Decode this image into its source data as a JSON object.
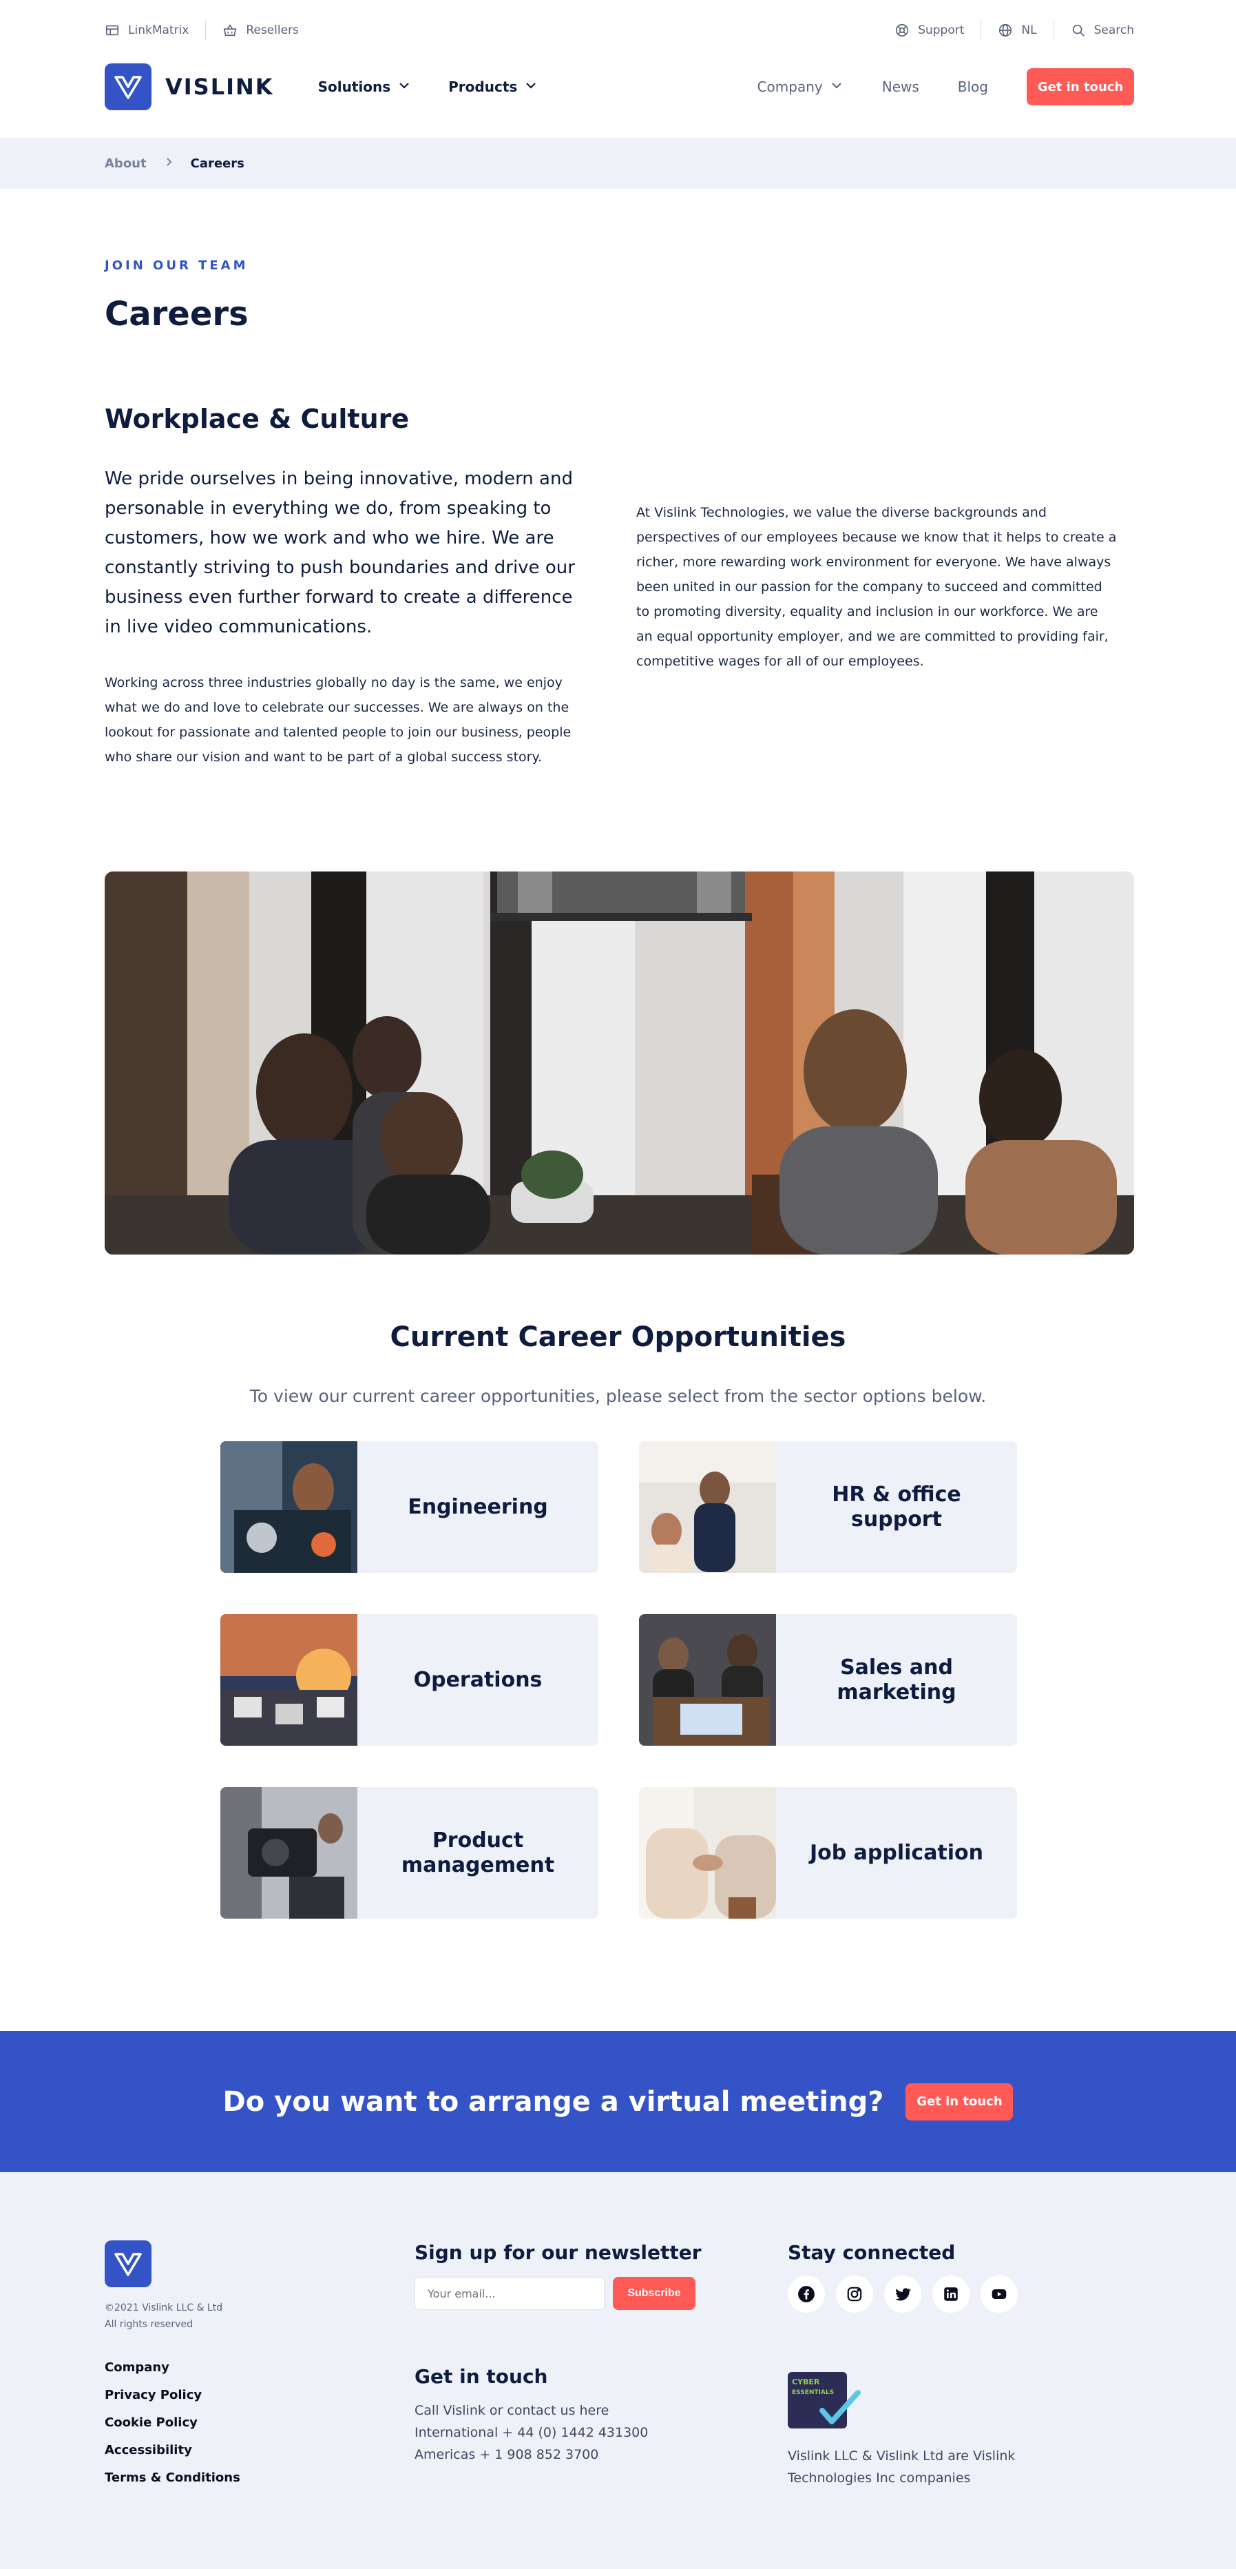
{
  "utility": {
    "left": [
      {
        "icon": "table-icon",
        "label": "LinkMatrix"
      },
      {
        "icon": "basket-icon",
        "label": "Resellers"
      }
    ],
    "right": [
      {
        "icon": "support-icon",
        "label": "Support"
      },
      {
        "icon": "globe-icon",
        "label": "NL"
      },
      {
        "icon": "search-icon",
        "label": "Search"
      }
    ]
  },
  "nav": {
    "brand": "VISLINK",
    "left": [
      "Solutions",
      "Products"
    ],
    "right": [
      {
        "label": "Company",
        "dropdown": true
      },
      {
        "label": "News",
        "dropdown": false
      },
      {
        "label": "Blog",
        "dropdown": false
      }
    ],
    "cta": "Get in touch"
  },
  "breadcrumb": {
    "parent": "About",
    "current": "Careers"
  },
  "intro": {
    "eyebrow": "JOIN OUR TEAM",
    "title": "Careers",
    "section_title": "Workplace & Culture",
    "lead": "We pride ourselves in being innovative, modern and personable in everything we do, from speaking to customers, how we work and who we hire. We are constantly striving to push boundaries and drive our business even further forward to create a difference in live video communications.",
    "body_left": "Working across three industries globally no day is the same, we enjoy what we do and love to celebrate our successes. We are always on the lookout for passionate and talented people to join our business, people who share our vision and want to be part of a global success story.",
    "body_right": "At Vislink Technologies, we value the diverse backgrounds and perspectives of our employees because we know that it helps to create a richer, more rewarding work environment for everyone. We have always been united in our passion for the company to succeed and committed to promoting diversity, equality and inclusion in our workforce. We are an equal opportunity employer, and we are committed to providing fair, competitive wages for all of our employees."
  },
  "opportunities": {
    "title": "Current Career Opportunities",
    "subtitle": "To view our current career opportunities, please select from the sector options below.",
    "cards": [
      {
        "label": "Engineering",
        "name": "card-engineering"
      },
      {
        "label": "HR & office support",
        "name": "card-hr-office-support"
      },
      {
        "label": "Operations",
        "name": "card-operations"
      },
      {
        "label": "Sales and marketing",
        "name": "card-sales-marketing"
      },
      {
        "label": "Product management",
        "name": "card-product-management"
      },
      {
        "label": "Job application",
        "name": "card-job-application"
      }
    ]
  },
  "banner": {
    "text": "Do you want to arrange a virtual meeting?",
    "cta": "Get in touch"
  },
  "footer": {
    "copyright_line1": "©2021 Vislink LLC & Ltd",
    "copyright_line2": "All rights reserved",
    "links": [
      "Company",
      "Privacy Policy",
      "Cookie Policy",
      "Accessibility",
      "Terms & Conditions"
    ],
    "newsletter_title": "Sign up for our newsletter",
    "email_placeholder": "Your email...",
    "subscribe": "Subscribe",
    "touch_title": "Get in touch",
    "touch_line1": "Call Vislink or contact us here",
    "touch_line2": "International + 44 (0) 1442 431300",
    "touch_line3": "Americas + 1 908 852 3700",
    "stay_title": "Stay connected",
    "social": [
      "facebook-icon",
      "instagram-icon",
      "twitter-icon",
      "linkedin-icon",
      "youtube-icon"
    ],
    "badge_text_1": "CYBER",
    "badge_text_2": "ESSENTIALS",
    "company_note": "Vislink LLC & Vislink Ltd are Vislink Technologies Inc companies"
  },
  "colors": {
    "accent": "#3353c6",
    "cta": "#ff5a55",
    "ink": "#0f1c3f",
    "muted_bg": "#eef1f7"
  }
}
